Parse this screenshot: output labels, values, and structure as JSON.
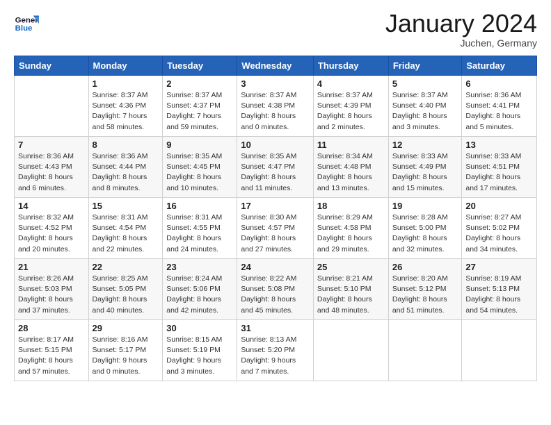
{
  "header": {
    "logo_line1": "General",
    "logo_line2": "Blue",
    "month": "January 2024",
    "location": "Juchen, Germany"
  },
  "weekdays": [
    "Sunday",
    "Monday",
    "Tuesday",
    "Wednesday",
    "Thursday",
    "Friday",
    "Saturday"
  ],
  "weeks": [
    [
      {
        "day": "",
        "info": ""
      },
      {
        "day": "1",
        "info": "Sunrise: 8:37 AM\nSunset: 4:36 PM\nDaylight: 7 hours\nand 58 minutes."
      },
      {
        "day": "2",
        "info": "Sunrise: 8:37 AM\nSunset: 4:37 PM\nDaylight: 7 hours\nand 59 minutes."
      },
      {
        "day": "3",
        "info": "Sunrise: 8:37 AM\nSunset: 4:38 PM\nDaylight: 8 hours\nand 0 minutes."
      },
      {
        "day": "4",
        "info": "Sunrise: 8:37 AM\nSunset: 4:39 PM\nDaylight: 8 hours\nand 2 minutes."
      },
      {
        "day": "5",
        "info": "Sunrise: 8:37 AM\nSunset: 4:40 PM\nDaylight: 8 hours\nand 3 minutes."
      },
      {
        "day": "6",
        "info": "Sunrise: 8:36 AM\nSunset: 4:41 PM\nDaylight: 8 hours\nand 5 minutes."
      }
    ],
    [
      {
        "day": "7",
        "info": "Sunrise: 8:36 AM\nSunset: 4:43 PM\nDaylight: 8 hours\nand 6 minutes."
      },
      {
        "day": "8",
        "info": "Sunrise: 8:36 AM\nSunset: 4:44 PM\nDaylight: 8 hours\nand 8 minutes."
      },
      {
        "day": "9",
        "info": "Sunrise: 8:35 AM\nSunset: 4:45 PM\nDaylight: 8 hours\nand 10 minutes."
      },
      {
        "day": "10",
        "info": "Sunrise: 8:35 AM\nSunset: 4:47 PM\nDaylight: 8 hours\nand 11 minutes."
      },
      {
        "day": "11",
        "info": "Sunrise: 8:34 AM\nSunset: 4:48 PM\nDaylight: 8 hours\nand 13 minutes."
      },
      {
        "day": "12",
        "info": "Sunrise: 8:33 AM\nSunset: 4:49 PM\nDaylight: 8 hours\nand 15 minutes."
      },
      {
        "day": "13",
        "info": "Sunrise: 8:33 AM\nSunset: 4:51 PM\nDaylight: 8 hours\nand 17 minutes."
      }
    ],
    [
      {
        "day": "14",
        "info": "Sunrise: 8:32 AM\nSunset: 4:52 PM\nDaylight: 8 hours\nand 20 minutes."
      },
      {
        "day": "15",
        "info": "Sunrise: 8:31 AM\nSunset: 4:54 PM\nDaylight: 8 hours\nand 22 minutes."
      },
      {
        "day": "16",
        "info": "Sunrise: 8:31 AM\nSunset: 4:55 PM\nDaylight: 8 hours\nand 24 minutes."
      },
      {
        "day": "17",
        "info": "Sunrise: 8:30 AM\nSunset: 4:57 PM\nDaylight: 8 hours\nand 27 minutes."
      },
      {
        "day": "18",
        "info": "Sunrise: 8:29 AM\nSunset: 4:58 PM\nDaylight: 8 hours\nand 29 minutes."
      },
      {
        "day": "19",
        "info": "Sunrise: 8:28 AM\nSunset: 5:00 PM\nDaylight: 8 hours\nand 32 minutes."
      },
      {
        "day": "20",
        "info": "Sunrise: 8:27 AM\nSunset: 5:02 PM\nDaylight: 8 hours\nand 34 minutes."
      }
    ],
    [
      {
        "day": "21",
        "info": "Sunrise: 8:26 AM\nSunset: 5:03 PM\nDaylight: 8 hours\nand 37 minutes."
      },
      {
        "day": "22",
        "info": "Sunrise: 8:25 AM\nSunset: 5:05 PM\nDaylight: 8 hours\nand 40 minutes."
      },
      {
        "day": "23",
        "info": "Sunrise: 8:24 AM\nSunset: 5:06 PM\nDaylight: 8 hours\nand 42 minutes."
      },
      {
        "day": "24",
        "info": "Sunrise: 8:22 AM\nSunset: 5:08 PM\nDaylight: 8 hours\nand 45 minutes."
      },
      {
        "day": "25",
        "info": "Sunrise: 8:21 AM\nSunset: 5:10 PM\nDaylight: 8 hours\nand 48 minutes."
      },
      {
        "day": "26",
        "info": "Sunrise: 8:20 AM\nSunset: 5:12 PM\nDaylight: 8 hours\nand 51 minutes."
      },
      {
        "day": "27",
        "info": "Sunrise: 8:19 AM\nSunset: 5:13 PM\nDaylight: 8 hours\nand 54 minutes."
      }
    ],
    [
      {
        "day": "28",
        "info": "Sunrise: 8:17 AM\nSunset: 5:15 PM\nDaylight: 8 hours\nand 57 minutes."
      },
      {
        "day": "29",
        "info": "Sunrise: 8:16 AM\nSunset: 5:17 PM\nDaylight: 9 hours\nand 0 minutes."
      },
      {
        "day": "30",
        "info": "Sunrise: 8:15 AM\nSunset: 5:19 PM\nDaylight: 9 hours\nand 3 minutes."
      },
      {
        "day": "31",
        "info": "Sunrise: 8:13 AM\nSunset: 5:20 PM\nDaylight: 9 hours\nand 7 minutes."
      },
      {
        "day": "",
        "info": ""
      },
      {
        "day": "",
        "info": ""
      },
      {
        "day": "",
        "info": ""
      }
    ]
  ]
}
